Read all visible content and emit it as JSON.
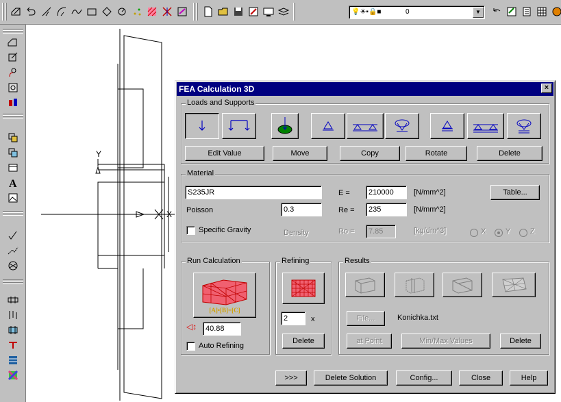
{
  "toolbar": {
    "layer_value": "0",
    "accent": "#000080"
  },
  "drawing": {
    "axis_y": "Y",
    "axis_x": "X"
  },
  "dialog": {
    "title": "FEA Calculation 3D",
    "close_glyph": "×",
    "loads_group": "Loads and Supports",
    "load_buttons": [
      "Edit Value",
      "Move",
      "Copy",
      "Rotate",
      "Delete"
    ],
    "material_group": "Material",
    "material_name": "S235JR",
    "poisson_label": "Poisson",
    "poisson_value": "0.3",
    "specific_gravity_label": "Specific Gravity",
    "density_label": "Density",
    "e_label": "E =",
    "e_value": "210000",
    "e_unit": "[N/mm^2]",
    "re_label": "Re =",
    "re_value": "235",
    "re_unit": "[N/mm^2]",
    "ro_label": "Ro =",
    "ro_value": "7.85",
    "ro_unit": "[kg/dm^3]",
    "table_button": "Table...",
    "axis_x": "X",
    "axis_y": "Y",
    "axis_z": "Z",
    "run_group": "Run Calculation",
    "run_formula": "[A]•[B]=[C]",
    "run_value": "40.88",
    "auto_refining_label": "Auto Refining",
    "refining_group": "Refining",
    "refining_value": "2",
    "refining_x": "x",
    "refining_delete": "Delete",
    "results_group": "Results",
    "file_button": "File...",
    "file_name": "Konichka.txt",
    "at_point_button": "at Point",
    "minmax_button": "Min/Max Values",
    "results_delete": "Delete",
    "bottom_buttons": [
      ">>>",
      "Delete Solution",
      "Config...",
      "Close",
      "Help"
    ]
  }
}
